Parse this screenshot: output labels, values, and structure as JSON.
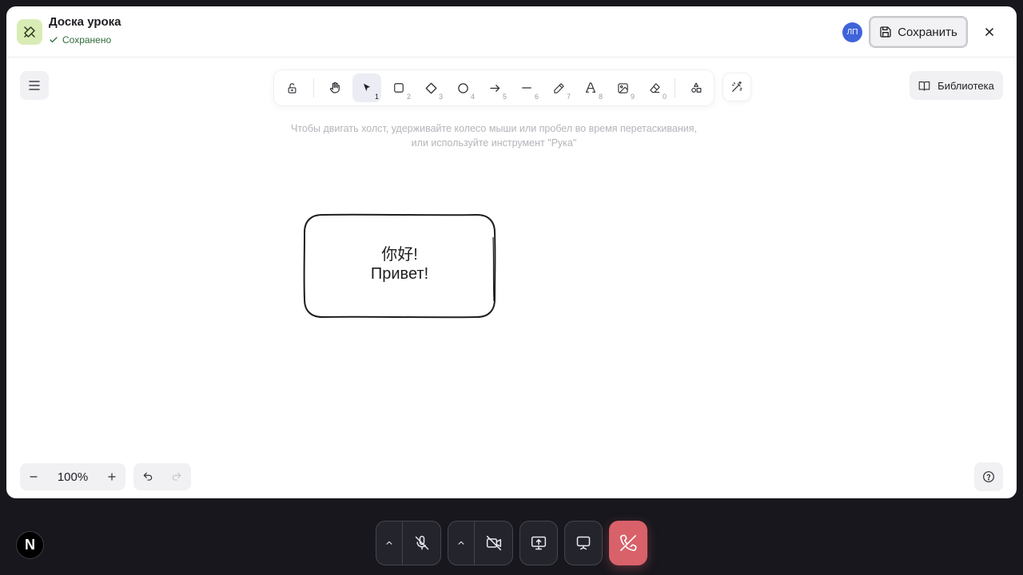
{
  "header": {
    "title": "Доска урока",
    "status": "Сохранено",
    "avatar_initials": "ЛП",
    "save_label": "Сохранить"
  },
  "toolbar": {
    "tools": [
      {
        "name": "lock",
        "key": ""
      },
      {
        "name": "hand",
        "key": ""
      },
      {
        "name": "selection",
        "key": "1",
        "active": true
      },
      {
        "name": "rectangle",
        "key": "2"
      },
      {
        "name": "diamond",
        "key": "3"
      },
      {
        "name": "ellipse",
        "key": "4"
      },
      {
        "name": "arrow",
        "key": "5"
      },
      {
        "name": "line",
        "key": "6"
      },
      {
        "name": "draw",
        "key": "7"
      },
      {
        "name": "text",
        "key": "8"
      },
      {
        "name": "image",
        "key": "9"
      },
      {
        "name": "eraser",
        "key": "0"
      },
      {
        "name": "more-shapes",
        "key": ""
      }
    ]
  },
  "hint": {
    "line1": "Чтобы двигать холст, удерживайте колесо мыши или пробел во время перетаскивания,",
    "line2": "или используйте инструмент \"Рука\""
  },
  "library": {
    "label": "Библиотека"
  },
  "canvas": {
    "card": {
      "line1": "你好!",
      "line2": "Привет!"
    }
  },
  "footer": {
    "zoom": "100%"
  },
  "call": {
    "logo": "N"
  },
  "colors": {
    "accent": "#3f63d9",
    "app_icon_bg": "#d9ecb5",
    "saved_green": "#2f6b3a",
    "hangup_red": "#d8616a",
    "call_bar_bg": "#17171d"
  }
}
